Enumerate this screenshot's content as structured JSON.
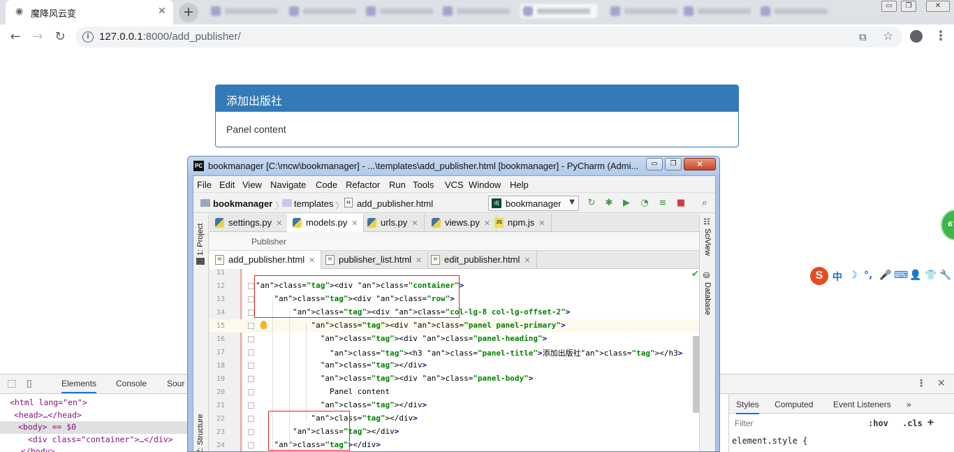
{
  "browser": {
    "tab_title": "魔降风云变",
    "tab_close": "✕",
    "new_tab": "+",
    "url_host": "127.0.0.1",
    "url_path": ":8000/add_publisher/",
    "window_buttons": [
      "▭",
      "❐",
      "✕"
    ]
  },
  "page": {
    "panel_title": "添加出版社",
    "panel_body": "Panel content"
  },
  "devtools": {
    "tabs": [
      "Elements",
      "Console",
      "Sour"
    ],
    "active_tab": "Elements",
    "dom": [
      {
        "text": "<html lang=\"en\">"
      },
      {
        "text": "<head>…</head>"
      },
      {
        "text": "<body> == $0"
      },
      {
        "text": "<div class=\"container\">…</div>"
      },
      {
        "text": "</body>"
      }
    ],
    "styles_tabs": [
      "Styles",
      "Computed",
      "Event Listeners",
      "»"
    ],
    "filter_placeholder": "Filter",
    "hov": ":hov",
    "cls": ".cls",
    "rule": "element.style {"
  },
  "pycharm": {
    "title": "bookmanager [C:\\mcw\\bookmanager] - ...\\templates\\add_publisher.html [bookmanager] - PyCharm (Admi...",
    "menu": [
      "File",
      "Edit",
      "View",
      "Navigate",
      "Code",
      "Refactor",
      "Run",
      "Tools",
      "VCS",
      "Window",
      "Help"
    ],
    "breadcrumbs": [
      "bookmanager",
      "templates",
      "add_publisher.html"
    ],
    "run_config": "bookmanager",
    "left_tools": [
      "1: Project",
      "Z: Structure"
    ],
    "right_tools": [
      "SciView",
      "Database"
    ],
    "tabs_row1": [
      {
        "label": "settings.py",
        "icon": "py"
      },
      {
        "label": "models.py",
        "icon": "py"
      },
      {
        "label": "urls.py",
        "icon": "py"
      },
      {
        "label": "views.py",
        "icon": "py"
      },
      {
        "label": "npm.js",
        "icon": "js"
      }
    ],
    "structure_label": "Publisher",
    "tabs_row2": [
      {
        "label": "add_publisher.html",
        "icon": "html"
      },
      {
        "label": "publisher_list.html",
        "icon": "html"
      },
      {
        "label": "edit_publisher.html",
        "icon": "html"
      }
    ],
    "code_lines": [
      {
        "n": "11",
        "code": ""
      },
      {
        "n": "12",
        "code": "<div class=\"container\">"
      },
      {
        "n": "13",
        "code": "    <div class=\"row\">"
      },
      {
        "n": "14",
        "code": "        <div class=\"col-lg-8 col-lg-offset-2\">"
      },
      {
        "n": "15",
        "code": "            <div class=\"panel panel-primary\">"
      },
      {
        "n": "16",
        "code": "              <div class=\"panel-heading\">"
      },
      {
        "n": "17",
        "code": "                <h3 class=\"panel-title\">添加出版社</h3>"
      },
      {
        "n": "18",
        "code": "              </div>"
      },
      {
        "n": "19",
        "code": "              <div class=\"panel-body\">"
      },
      {
        "n": "20",
        "code": "                Panel content"
      },
      {
        "n": "21",
        "code": "              </div>"
      },
      {
        "n": "22",
        "code": "            </div>"
      },
      {
        "n": "23",
        "code": "        </div>"
      },
      {
        "n": "24",
        "code": "    </div>"
      }
    ]
  },
  "ime": {
    "logo": "S",
    "glyphs": [
      "中",
      "☽",
      "°,",
      "🎤",
      "⌨",
      "👤",
      "👕",
      "🔧"
    ]
  },
  "badge": "67"
}
